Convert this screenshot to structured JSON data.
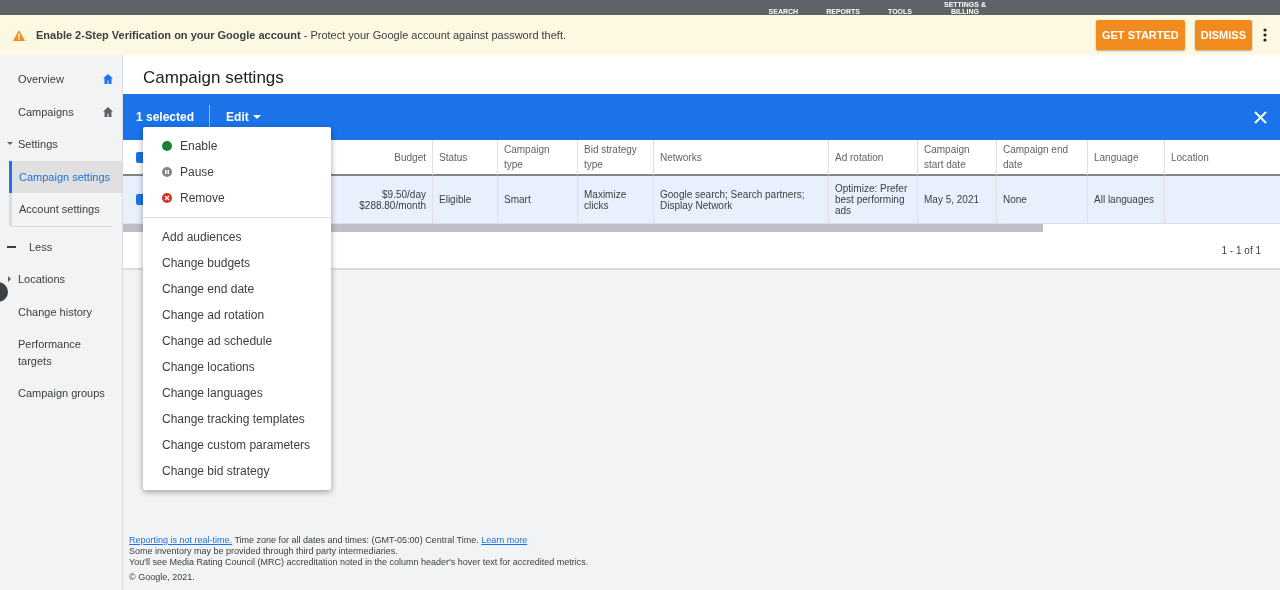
{
  "top_bar": {
    "items": [
      "SEARCH",
      "REPORTS",
      "TOOLS",
      "SETTINGS & BILLING"
    ]
  },
  "banner": {
    "title": "Enable 2-Step Verification on your Google account",
    "message": " - Protect your Google account against password theft.",
    "buttons": [
      "GET STARTED",
      "DISMISS"
    ]
  },
  "sidebar": {
    "items": [
      {
        "label": "Overview",
        "kind": "home"
      },
      {
        "label": "Campaigns",
        "kind": "home"
      },
      {
        "label": "Settings",
        "kind": "group",
        "expanded": true,
        "children": [
          {
            "label": "Campaign settings",
            "kind": "sub",
            "selected": true
          },
          {
            "label": "Account settings",
            "kind": "sub",
            "selected": false
          }
        ]
      },
      {
        "label": "Less",
        "kind": "less"
      },
      {
        "label": "Locations",
        "kind": "group",
        "expanded": false
      },
      {
        "label": "Change history",
        "kind": "link"
      },
      {
        "label": "Performance targets",
        "kind": "link"
      },
      {
        "label": "Campaign groups",
        "kind": "link"
      }
    ]
  },
  "page_title": "Campaign settings",
  "selection_bar": {
    "count": "1 selected",
    "edit": "Edit"
  },
  "edit_menu": {
    "status_items": [
      {
        "label": "Enable",
        "kind": "enable",
        "color": "#188038"
      },
      {
        "label": "Pause",
        "kind": "pause",
        "color": "#80868b"
      },
      {
        "label": "Remove",
        "kind": "remove",
        "color": "#d93025"
      }
    ],
    "items": [
      "Add audiences",
      "Change budgets",
      "Change end date",
      "Change ad rotation",
      "Change ad schedule",
      "Change locations",
      "Change languages",
      "Change tracking templates",
      "Change custom parameters",
      "Change bid strategy"
    ]
  },
  "table": {
    "columns": [
      "Budget",
      "Status",
      "Campaign type",
      "Bid strategy type",
      "Networks",
      "Ad rotation",
      "Campaign start date",
      "Campaign end date",
      "Language",
      "Location"
    ],
    "header_checked": true,
    "rows": [
      {
        "checked": true,
        "selected": true,
        "cells": [
          "$9.50/day\n$288.80/month",
          "Eligible",
          "Smart",
          "Maximize clicks",
          "Google search; Search partners; Display Network",
          "Optimize: Prefer best performing ads",
          "May 5, 2021",
          "None",
          "All languages",
          ""
        ]
      }
    ],
    "pagination": "1 - 1 of 1"
  },
  "footer": {
    "lines": [
      {
        "parts": [
          {
            "text": "Reporting is not real-time.",
            "kind": "link"
          },
          {
            "text": " Time zone for all dates and times: (GMT-05:00) Central Time. ",
            "kind": "text"
          },
          {
            "text": "Learn more",
            "kind": "link"
          }
        ]
      },
      {
        "parts": [
          {
            "text": "Some inventory may be provided through third party intermediaries.",
            "kind": "text"
          }
        ]
      },
      {
        "parts": [
          {
            "text": "You'll see Media Rating Council (MRC) accreditation noted in the column header's hover text for accredited metrics.",
            "kind": "text"
          }
        ]
      }
    ],
    "copyright": "© Google, 2021."
  }
}
